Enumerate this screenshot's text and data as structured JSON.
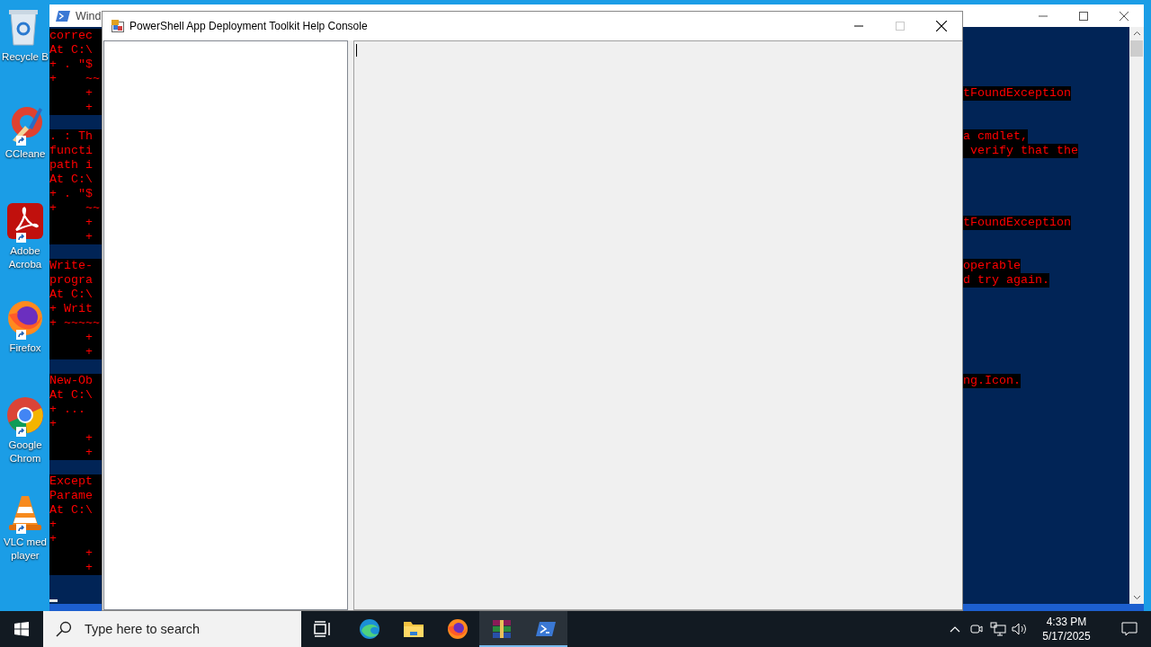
{
  "desktop_icons": [
    {
      "label": "Recycle B",
      "shortcut": false
    },
    {
      "label": "CCleane",
      "shortcut": true
    },
    {
      "label": "Adobe Acroba",
      "shortcut": true
    },
    {
      "label": "Firefox",
      "shortcut": true
    },
    {
      "label": "Google Chrom",
      "shortcut": true
    },
    {
      "label": "VLC med player",
      "shortcut": true
    }
  ],
  "powershell_window": {
    "title": "Wind",
    "console_rows": [
      {
        "left": "correc"
      },
      {
        "left": "At C:\\"
      },
      {
        "left": "+ . \"$"
      },
      {
        "left": "+    ~~"
      },
      {
        "left": "     +",
        "right": "tFoundException"
      },
      {
        "left": "     +"
      },
      {},
      {
        "left": ". : Th",
        "right": "a cmdlet,"
      },
      {
        "left": "functi",
        "right": " verify that the"
      },
      {
        "left": "path i"
      },
      {
        "left": "At C:\\"
      },
      {
        "left": "+ . \"$"
      },
      {
        "left": "+    ~~"
      },
      {
        "left": "     +",
        "right": "tFoundException"
      },
      {
        "left": "     +"
      },
      {},
      {
        "left": "Write-",
        "right": "operable"
      },
      {
        "left": "progra",
        "right": "d try again."
      },
      {
        "left": "At C:\\"
      },
      {
        "left": "+ Writ"
      },
      {
        "left": "+ ~~~~~"
      },
      {
        "left": "     +"
      },
      {
        "left": "     +"
      },
      {},
      {
        "left": "New-Ob",
        "right": "ng.Icon."
      },
      {
        "left": "At C:\\"
      },
      {
        "left": "+ ..."
      },
      {
        "left": "+"
      },
      {
        "left": "     +"
      },
      {
        "left": "     +"
      },
      {},
      {
        "left": "Except"
      },
      {
        "left": "Parame"
      },
      {
        "left": "At C:\\"
      },
      {
        "left": "+"
      },
      {
        "left": "+"
      },
      {
        "left": "     +"
      },
      {
        "left": "     +"
      },
      {},
      {
        "cursor": true
      }
    ]
  },
  "dialog": {
    "title": "PowerShell App Deployment Toolkit Help Console",
    "maximize_disabled": true
  },
  "taskbar": {
    "search": {
      "placeholder": "Type here to search"
    },
    "apps": [
      {
        "running": false
      },
      {
        "running": false
      },
      {
        "running": false
      },
      {
        "running": true
      },
      {
        "running": true
      }
    ],
    "clock": {
      "time": "4:33 PM",
      "date": "5/17/2025"
    }
  }
}
